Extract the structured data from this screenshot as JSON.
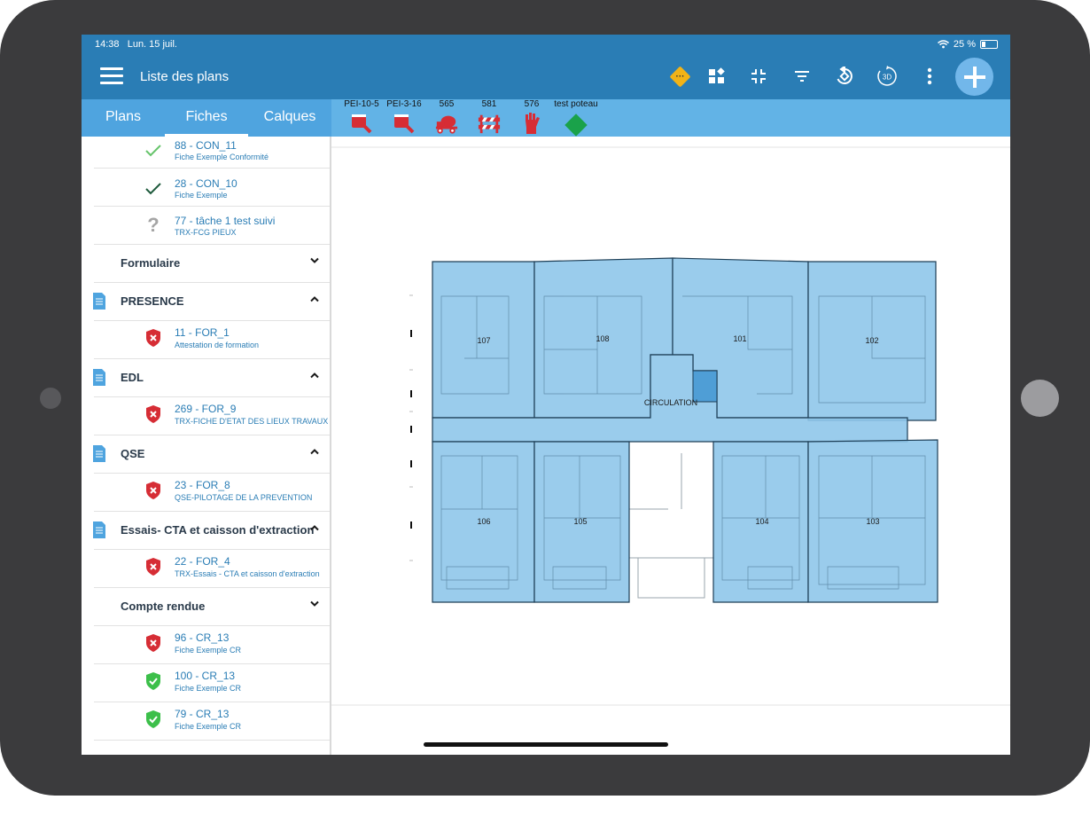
{
  "status": {
    "time": "14:38",
    "date": "Lun. 15 juil.",
    "battery": "25 %"
  },
  "header": {
    "title": "Liste des plans"
  },
  "toolbar": {
    "icons": [
      "warning-diamond-icon",
      "layout-icon",
      "collapse-icon",
      "filter-icon",
      "rotate-icon",
      "3d-icon",
      "more-vertical-icon",
      "add-icon"
    ],
    "three_d_label": "3D"
  },
  "tabs": [
    {
      "label": "Plans"
    },
    {
      "label": "Fiches",
      "active": true
    },
    {
      "label": "Calques"
    }
  ],
  "layers": [
    {
      "label": "PEI-10-5",
      "icon": "paint-bucket-icon"
    },
    {
      "label": "PEI-3-16",
      "icon": "paint-bucket-icon"
    },
    {
      "label": "565",
      "icon": "concrete-mixer-icon"
    },
    {
      "label": "581",
      "icon": "barrier-icon"
    },
    {
      "label": "576",
      "icon": "glove-icon"
    },
    {
      "label": "test poteau",
      "icon": "green-diamond-icon"
    }
  ],
  "sidebar": {
    "top_items": [
      {
        "title": "88 - CON_11",
        "sub": "Fiche Exemple Conformité",
        "status": "check-light"
      },
      {
        "title": "28 - CON_10",
        "sub": "Fiche Exemple",
        "status": "check-dark"
      },
      {
        "title": "77 - tâche 1 test suivi",
        "sub": "TRX-FCG PIEUX",
        "status": "question"
      }
    ],
    "sections": [
      {
        "title": "Formulaire",
        "doc": false,
        "expanded": false,
        "items": []
      },
      {
        "title": "PRESENCE",
        "doc": true,
        "expanded": true,
        "items": [
          {
            "title": "11 - FOR_1",
            "sub": "Attestation de formation",
            "status": "shield-red"
          }
        ]
      },
      {
        "title": "EDL",
        "doc": true,
        "expanded": true,
        "items": [
          {
            "title": "269 - FOR_9",
            "sub": "TRX-FICHE D'ETAT DES LIEUX TRAVAUX",
            "status": "shield-red"
          }
        ]
      },
      {
        "title": "QSE",
        "doc": true,
        "expanded": true,
        "items": [
          {
            "title": "23 - FOR_8",
            "sub": "QSE-PILOTAGE DE LA PREVENTION",
            "status": "shield-red"
          }
        ]
      },
      {
        "title": "Essais- CTA et caisson d'extraction",
        "doc": true,
        "expanded": true,
        "items": [
          {
            "title": "22 - FOR_4",
            "sub": "TRX-Essais - CTA et caisson d'extraction",
            "status": "shield-red"
          }
        ]
      },
      {
        "title": "Compte rendue",
        "doc": false,
        "expanded": false,
        "items": [
          {
            "title": "96 - CR_13",
            "sub": "Fiche Exemple CR",
            "status": "shield-red"
          },
          {
            "title": "100 - CR_13",
            "sub": "Fiche Exemple CR",
            "status": "shield-green"
          },
          {
            "title": "79 - CR_13",
            "sub": "Fiche Exemple CR",
            "status": "shield-green"
          }
        ]
      }
    ]
  },
  "plan": {
    "rooms": [
      "107",
      "108",
      "101",
      "102",
      "106",
      "105",
      "104",
      "103"
    ],
    "corridor_label": "CIRCULATION"
  },
  "colors": {
    "header": "#2a7db5",
    "tab_bar": "#4fa4df",
    "layer_bar": "#62b3e6",
    "room_fill": "#8fc6ea",
    "room_stroke": "#1d3e56",
    "red": "#d62d35",
    "green": "#3cbf4a"
  }
}
